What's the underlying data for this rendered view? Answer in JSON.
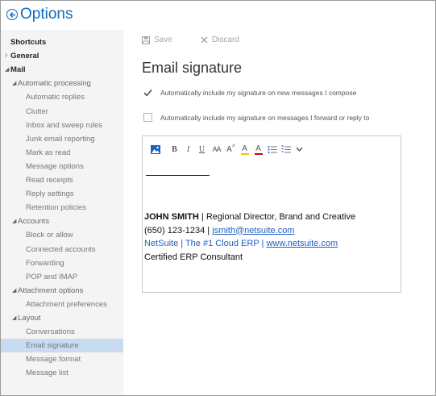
{
  "header": {
    "title": "Options"
  },
  "sidebar": {
    "items": [
      {
        "label": "Shortcuts",
        "level": 0,
        "caret": ""
      },
      {
        "label": "General",
        "level": 0,
        "caret": "›"
      },
      {
        "label": "Mail",
        "level": 0,
        "caret": "◢"
      },
      {
        "label": "Automatic processing",
        "level": 1,
        "caret": "◢"
      },
      {
        "label": "Automatic replies",
        "level": 2,
        "caret": ""
      },
      {
        "label": "Clutter",
        "level": 2,
        "caret": ""
      },
      {
        "label": "Inbox and sweep rules",
        "level": 2,
        "caret": ""
      },
      {
        "label": "Junk email reporting",
        "level": 2,
        "caret": ""
      },
      {
        "label": "Mark as read",
        "level": 2,
        "caret": ""
      },
      {
        "label": "Message options",
        "level": 2,
        "caret": ""
      },
      {
        "label": "Read receipts",
        "level": 2,
        "caret": ""
      },
      {
        "label": "Reply settings",
        "level": 2,
        "caret": ""
      },
      {
        "label": "Retention policies",
        "level": 2,
        "caret": ""
      },
      {
        "label": "Accounts",
        "level": 1,
        "caret": "◢"
      },
      {
        "label": "Block or allow",
        "level": 2,
        "caret": ""
      },
      {
        "label": "Connected accounts",
        "level": 2,
        "caret": ""
      },
      {
        "label": "Forwarding",
        "level": 2,
        "caret": ""
      },
      {
        "label": "POP and IMAP",
        "level": 2,
        "caret": ""
      },
      {
        "label": "Attachment options",
        "level": 1,
        "caret": "◢"
      },
      {
        "label": "Attachment preferences",
        "level": 2,
        "caret": ""
      },
      {
        "label": "Layout",
        "level": 1,
        "caret": "◢"
      },
      {
        "label": "Conversations",
        "level": 2,
        "caret": ""
      },
      {
        "label": "Email signature",
        "level": 2,
        "caret": "",
        "selected": true
      },
      {
        "label": "Message format",
        "level": 2,
        "caret": ""
      },
      {
        "label": "Message list",
        "level": 2,
        "caret": ""
      }
    ]
  },
  "toolbar": {
    "save_label": "Save",
    "discard_label": "Discard"
  },
  "main": {
    "title": "Email signature",
    "options": [
      {
        "label": "Automatically include my signature on new messages I compose",
        "checked": true
      },
      {
        "label": "Automatically include my signature on messages I forward or reply to",
        "checked": false
      }
    ]
  },
  "editor_toolbar": {
    "buttons": [
      {
        "name": "insert-image-icon",
        "glyph": ""
      },
      {
        "name": "bold-icon",
        "glyph": "B"
      },
      {
        "name": "italic-icon",
        "glyph": "I"
      },
      {
        "name": "underline-icon",
        "glyph": "U"
      },
      {
        "name": "font-size-icon",
        "glyph": "AA"
      },
      {
        "name": "grow-font-icon",
        "glyph": "A"
      },
      {
        "name": "highlight-icon",
        "glyph": "A"
      },
      {
        "name": "font-color-icon",
        "glyph": "A"
      },
      {
        "name": "bullets-icon",
        "glyph": ""
      },
      {
        "name": "numbering-icon",
        "glyph": ""
      },
      {
        "name": "more-chevron-icon",
        "glyph": ""
      }
    ]
  },
  "signature": {
    "name": "JOHN SMITH",
    "title_sep": " | ",
    "title": "Regional Director, Brand and Creative",
    "phone": "(650) 123-1234",
    "phone_sep": " | ",
    "email": "jsmith@netsuite.com",
    "company": "NetSuite | The #1 Cloud ERP",
    "company_sep": " | ",
    "website": "www.netsuite.com",
    "certification": "Certified ERP Consultant"
  },
  "colors": {
    "accent": "#0f6cbd",
    "selected_bg": "#c7dcf0",
    "sidebar_bg": "#f4f4f4",
    "link": "#1f5fbf"
  }
}
